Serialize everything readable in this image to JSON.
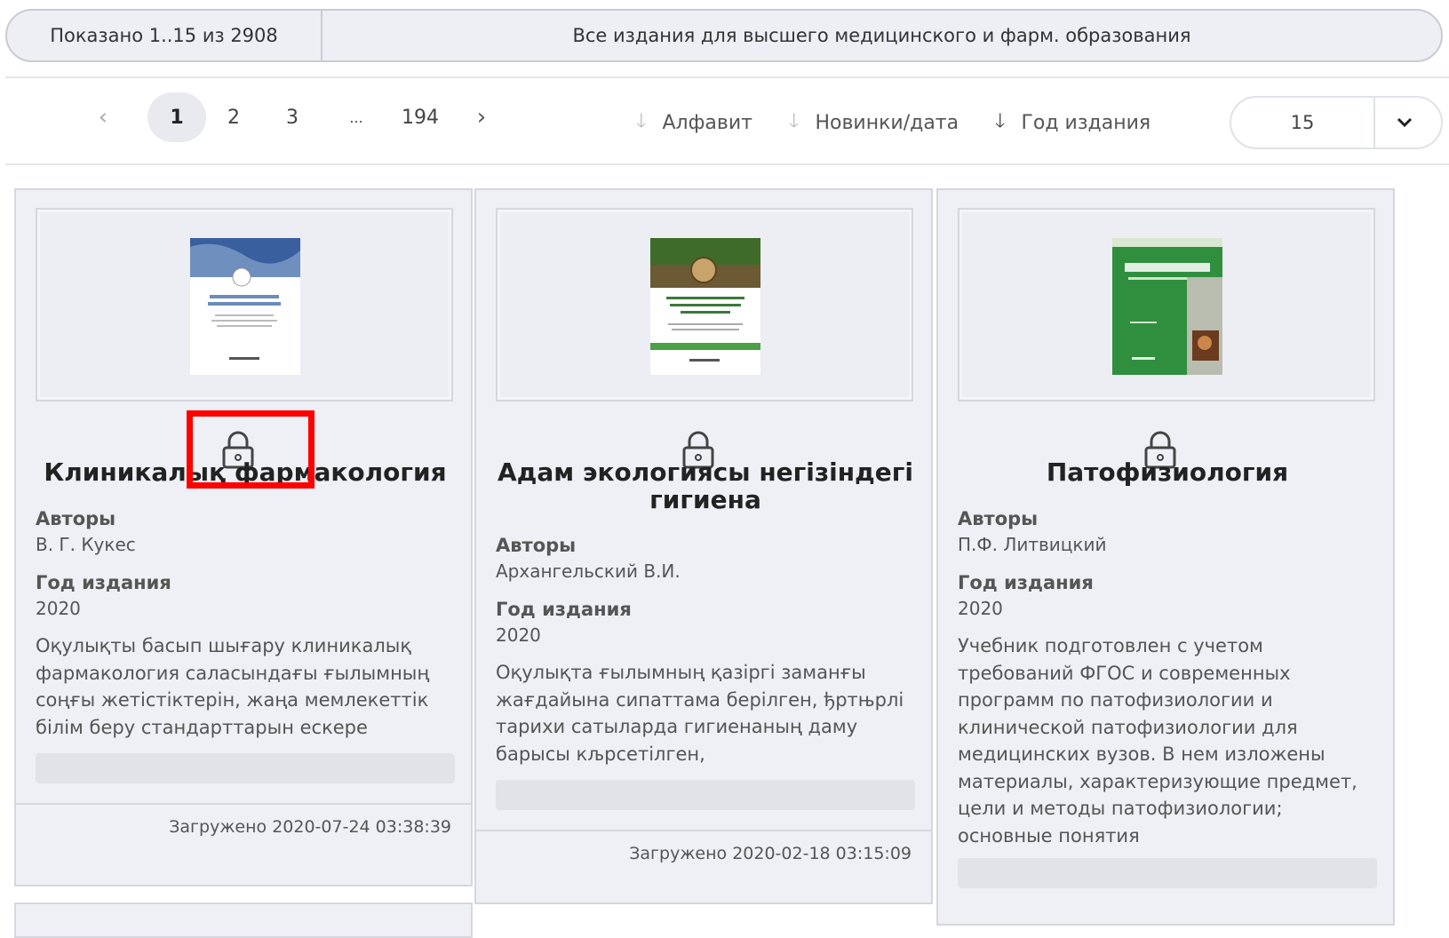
{
  "summary": {
    "shown": "Показано 1..15 из 2908",
    "heading": "Все издания для высшего медицинского и фарм. образования"
  },
  "pagination": {
    "prev": "‹",
    "pages": [
      "1",
      "2",
      "3",
      "...",
      "194"
    ],
    "next": "›",
    "current": "1"
  },
  "sort": {
    "alphabet": "Алфавит",
    "newest": "Новинки/дата",
    "year": "Год издания"
  },
  "per_page": {
    "value": "15"
  },
  "cards": [
    {
      "title": "Клиникалық фармакология",
      "authors_label": "Авторы",
      "authors": "В. Г. Кукес",
      "year_label": "Год издания",
      "year": "2020",
      "description": "Оқулықты басып шығару клиникалық фармакология саласындағы ғылымның соңғы жетістіктерін, жаңа мемлекеттік білім беру стандарттарын ескере",
      "uploaded": "Загружено 2020-07-24 03:38:39",
      "cover_colors": [
        "#3a5f9e",
        "#ffffff"
      ]
    },
    {
      "title": "Адам экологиясы негізіндегі гигиена",
      "authors_label": "Авторы",
      "authors": "Архангельский В.И.",
      "year_label": "Год издания",
      "year": "2020",
      "description": "Оқулықта ғылымның қазіргі заманғы жағдайына сипаттама берілген, ђртњрлі тарихи сатыларда гигиенаның даму барысы кљрсетілген,",
      "uploaded": "Загружено 2020-02-18 03:15:09",
      "cover_colors": [
        "#3f6b2a",
        "#ffffff"
      ]
    },
    {
      "title": "Патофизиология",
      "authors_label": "Авторы",
      "authors": "П.Ф. Литвицкий",
      "year_label": "Год издания",
      "year": "2020",
      "description": "Учебник подготовлен с учетом требований ФГОС и современных программ по патофизиологии и клинической патофизиологии для медицинских вузов. В нем изложены материалы, характеризующие предмет, цели и методы патофизиологии; основные понятия",
      "cover_colors": [
        "#2f8f3e",
        "#ffffff"
      ]
    }
  ],
  "colors": {
    "highlight": "#ff0000",
    "card_bg": "#eef0f5"
  }
}
